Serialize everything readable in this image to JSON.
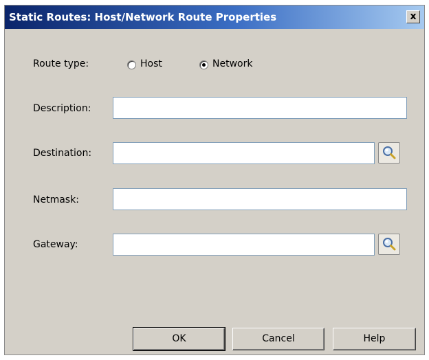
{
  "window": {
    "title": "Static Routes: Host/Network Route Properties",
    "close_label": "x"
  },
  "route_type": {
    "label": "Route type:",
    "options": [
      {
        "label": "Host",
        "selected": false
      },
      {
        "label": "Network",
        "selected": true
      }
    ]
  },
  "fields": {
    "description": {
      "label": "Description:",
      "value": ""
    },
    "destination": {
      "label": "Destination:",
      "value": ""
    },
    "netmask": {
      "label": "Netmask:",
      "value": ""
    },
    "gateway": {
      "label": "Gateway:",
      "value": ""
    }
  },
  "icons": {
    "lookup": "magnifier-icon"
  },
  "buttons": {
    "ok": "OK",
    "cancel": "Cancel",
    "help": "Help"
  }
}
